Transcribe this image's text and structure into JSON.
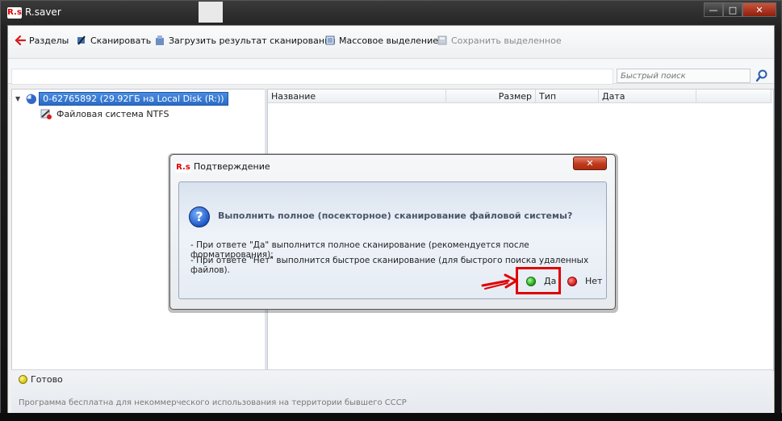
{
  "window": {
    "logo": "R.s",
    "title": "R.saver"
  },
  "toolbar": {
    "partitions": "Разделы",
    "scan": "Сканировать",
    "load_scan": "Загрузить результат сканирования",
    "mass_select": "Массовое выделение",
    "save_selected": "Сохранить выделенное"
  },
  "search": {
    "placeholder": "Быстрый поиск"
  },
  "tree": {
    "disk": "0-62765892 (29.92ГБ на Local Disk (R:))",
    "fs": "Файловая система NTFS"
  },
  "columns": {
    "name": "Название",
    "size": "Размер",
    "type": "Тип",
    "date": "Дата"
  },
  "status": {
    "text": "Готово",
    "footer": "Программа бесплатна для некоммерческого использования на территории бывшего СССР"
  },
  "dialog": {
    "logo": "R.s",
    "title": "Подтверждение",
    "question": "Выполнить полное (посекторное) сканирование файловой системы?",
    "line_yes": "- При ответе \"Да\" выполнится полное сканирование (рекомендуется после форматирования);",
    "line_no": "- При ответе \"Нет\" выполнится быстрое сканирование (для быстрого поиска удаленных файлов).",
    "yes": "Да",
    "no": "Нет"
  },
  "colors": {
    "highlight": "#e10000",
    "selection": "#2a6cc6"
  }
}
